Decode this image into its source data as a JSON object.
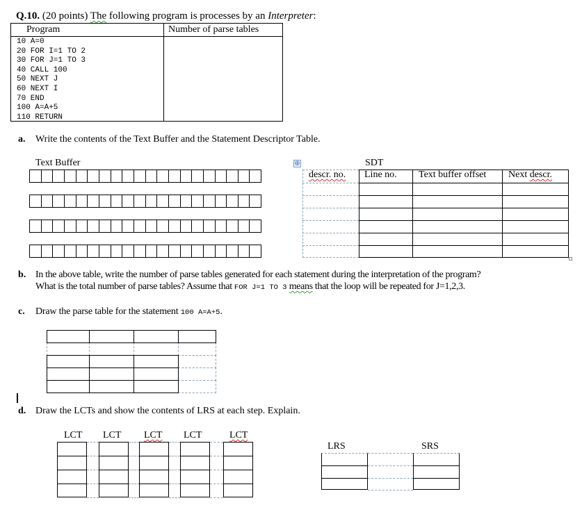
{
  "question": {
    "number": "Q.10.",
    "points": "(20 points)",
    "intro_pre": "The",
    "intro_mid": " following program is processes by an ",
    "intro_italic": "Interpreter",
    "intro_end": ":"
  },
  "program_table": {
    "headers": [
      "Program",
      "Number of parse tables"
    ],
    "lines": [
      "10 A=0",
      "20 FOR I=1 TO 2",
      "30 FOR J=1 TO 3",
      "40 CALL 100",
      "50 NEXT J",
      "60 NEXT I",
      "70 END",
      "100 A=A+5",
      "110 RETURN"
    ],
    "parse_table_counts": [
      "",
      "",
      "",
      "",
      "",
      "",
      "",
      "",
      ""
    ]
  },
  "part_a": {
    "label": "a.",
    "text": "Write the contents of the Text Buffer and the Statement Descriptor Table.",
    "text_buffer_label": "Text Buffer",
    "text_buffer_rows": 4,
    "text_buffer_cells_per_row": 20,
    "sdt_title": "SDT",
    "sdt_headers": [
      "descr. no.",
      "Line no.",
      "Text buffer offset",
      "Next descr."
    ],
    "sdt_rows": 6
  },
  "part_b": {
    "label": "b.",
    "line1": "In the above table, write the number of parse tables generated for each statement during the interpretation of the program?",
    "line2_pre": "What is the total number of parse tables? Assume that ",
    "line2_code": "FOR J=1 TO 3",
    "line2_mid": " ",
    "line2_word": "means",
    "line2_end": " that the loop will be repeated for J=1,2,3."
  },
  "part_c": {
    "label": "c.",
    "text_pre": "Draw the parse table for the statement ",
    "code": "100 A=A+5",
    "text_end": "."
  },
  "part_d": {
    "label": "d.",
    "text": "Draw the LCTs and show the contents of LRS at each step. Explain.",
    "lct_labels": [
      "LCT",
      "LCT",
      "LCT",
      "LCT",
      "LCT"
    ],
    "lrs_label": "LRS",
    "srs_label": "SRS"
  },
  "icons": {
    "table_move_handle": "⊕"
  }
}
